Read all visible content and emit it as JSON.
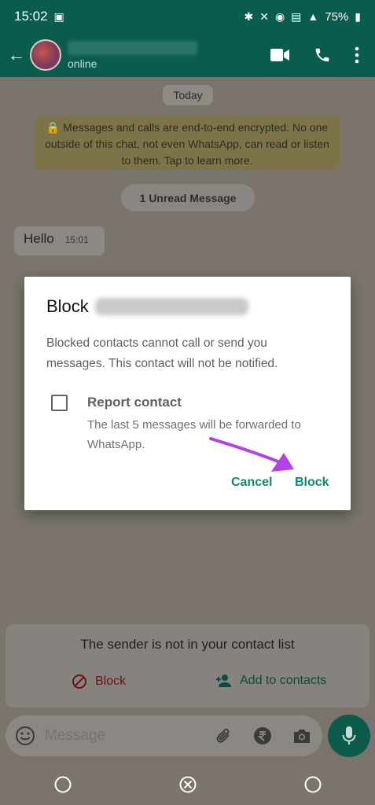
{
  "status_bar": {
    "time": "15:02",
    "battery": "75%"
  },
  "app_bar": {
    "contact_status": "online"
  },
  "chat": {
    "date_chip": "Today",
    "encryption_notice": "🔒 Messages and calls are end-to-end encrypted. No one outside of this chat, not even WhatsApp, can read or listen to them. Tap to learn more.",
    "unread_label": "1 Unread Message",
    "message": {
      "text": "Hello",
      "time": "15:01"
    }
  },
  "dialog": {
    "title": "Block",
    "body": "Blocked contacts cannot call or send you messages. This contact will not be notified.",
    "report_title": "Report contact",
    "report_desc": "The last 5 messages will be forwarded to WhatsApp.",
    "cancel_label": "Cancel",
    "block_label": "Block",
    "report_checked": false
  },
  "sender_panel": {
    "text": "The sender is not in your contact list",
    "block_label": "Block",
    "add_label": "Add to contacts"
  },
  "input": {
    "placeholder": "Message"
  },
  "colors": {
    "accent": "#0b8a74",
    "header": "#0a5c4f",
    "arrow": "#b342e6"
  }
}
